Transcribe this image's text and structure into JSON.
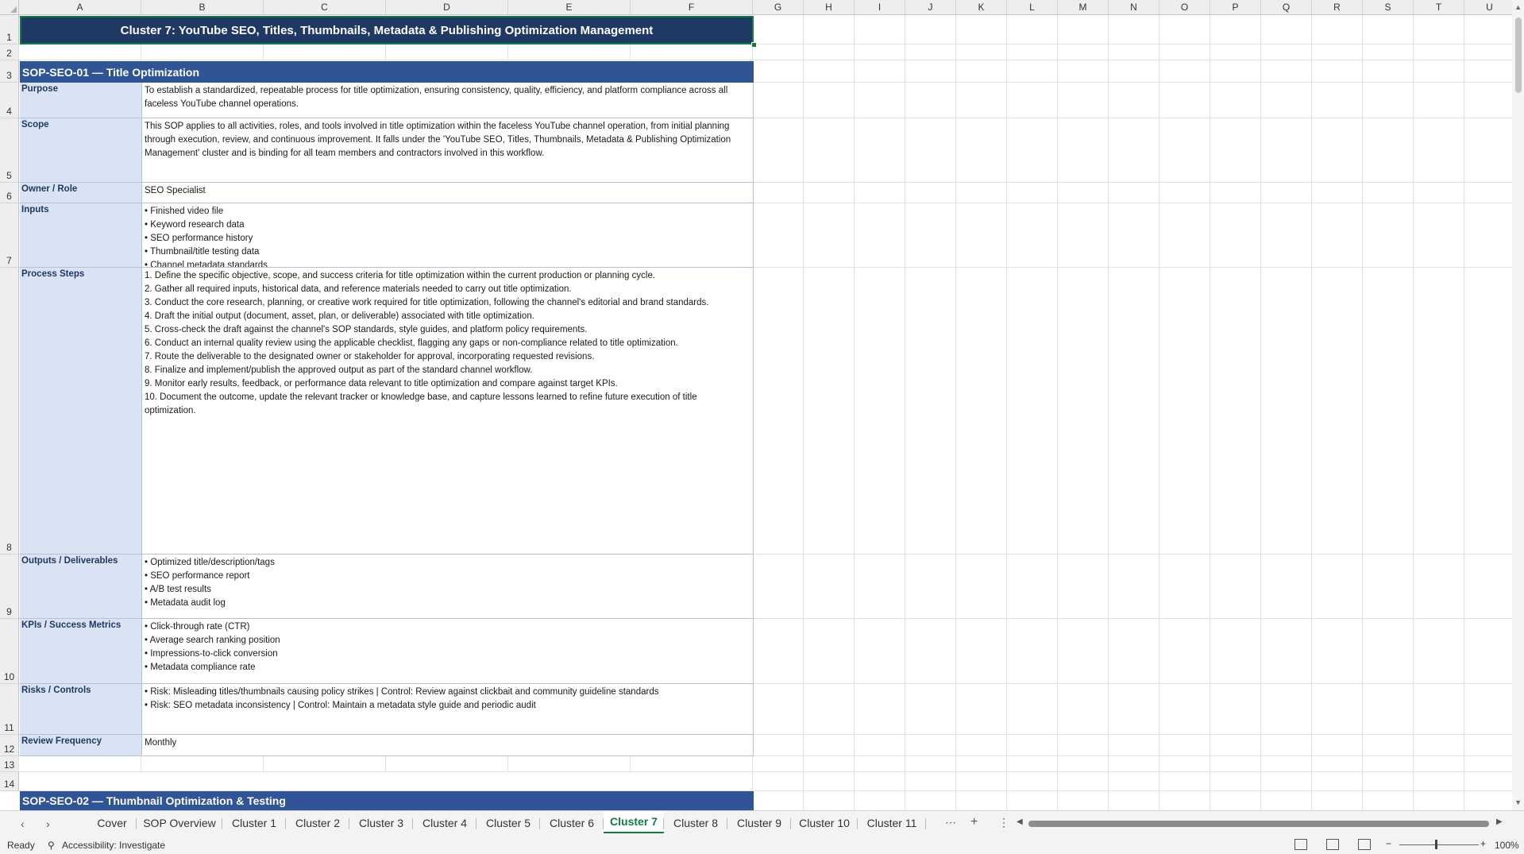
{
  "sheet": {
    "columns": [
      "A",
      "B",
      "C",
      "D",
      "E",
      "F",
      "G",
      "H",
      "I",
      "J",
      "K",
      "L",
      "M",
      "N",
      "O",
      "P",
      "Q",
      "R",
      "S",
      "T",
      "U"
    ],
    "rows": [
      "1",
      "2",
      "3",
      "4",
      "5",
      "6",
      "7",
      "8",
      "9",
      "10",
      "11",
      "12",
      "13",
      "14"
    ],
    "title": "Cluster 7: YouTube SEO, Titles, Thumbnails, Metadata & Publishing Optimization Management",
    "section1_header": "SOP-SEO-01  —  Title Optimization",
    "fields": [
      {
        "label": "Purpose",
        "value": "To establish a standardized, repeatable process for title optimization, ensuring consistency, quality, efficiency, and platform compliance across all faceless YouTube channel operations."
      },
      {
        "label": "Scope",
        "value": "This SOP applies to all activities, roles, and tools involved in title optimization within the faceless YouTube channel operation, from initial planning through execution, review, and continuous improvement. It falls under the 'YouTube SEO, Titles, Thumbnails, Metadata & Publishing Optimization Management' cluster and is binding for all team members and contractors involved in this workflow."
      },
      {
        "label": "Owner / Role",
        "value": "SEO Specialist"
      },
      {
        "label": "Inputs",
        "value": "• Finished video file\n• Keyword research data\n• SEO performance history\n• Thumbnail/title testing data\n• Channel metadata standards"
      },
      {
        "label": "Process Steps",
        "value": "1. Define the specific objective, scope, and success criteria for title optimization within the current production or planning cycle.\n2. Gather all required inputs, historical data, and reference materials needed to carry out title optimization.\n3. Conduct the core research, planning, or creative work required for title optimization, following the channel's editorial and brand standards.\n4. Draft the initial output (document, asset, plan, or deliverable) associated with title optimization.\n5. Cross-check the draft against the channel's SOP standards, style guides, and platform policy requirements.\n6. Conduct an internal quality review using the applicable checklist, flagging any gaps or non-compliance related to title optimization.\n7. Route the deliverable to the designated owner or stakeholder for approval, incorporating requested revisions.\n8. Finalize and implement/publish the approved output as part of the standard channel workflow.\n9. Monitor early results, feedback, or performance data relevant to title optimization and compare against target KPIs.\n10. Document the outcome, update the relevant tracker or knowledge base, and capture lessons learned to refine future execution of title optimization."
      },
      {
        "label": "Outputs / Deliverables",
        "value": "• Optimized title/description/tags\n• SEO performance report\n• A/B test results\n• Metadata audit log"
      },
      {
        "label": "KPIs / Success Metrics",
        "value": "• Click-through rate (CTR)\n• Average search ranking position\n• Impressions-to-click conversion\n• Metadata compliance rate"
      },
      {
        "label": "Risks / Controls",
        "value": "• Risk: Misleading titles/thumbnails causing policy strikes | Control: Review against clickbait and community guideline standards\n• Risk: SEO metadata inconsistency | Control: Maintain a metadata style guide and periodic audit"
      },
      {
        "label": "Review Frequency",
        "value": "Monthly"
      }
    ],
    "section2_header": "SOP-SEO-02  —  Thumbnail Optimization & Testing"
  },
  "tabs": [
    "Cover",
    "SOP Overview",
    "Cluster 1",
    "Cluster 2",
    "Cluster 3",
    "Cluster 4",
    "Cluster 5",
    "Cluster 6",
    "Cluster 7",
    "Cluster 8",
    "Cluster 9",
    "Cluster 10",
    "Cluster 11"
  ],
  "active_tab": "Cluster 7",
  "status": {
    "ready": "Ready",
    "accessibility": "Accessibility: Investigate",
    "zoom": "100%"
  },
  "colors": {
    "title_bg": "#1f3864",
    "section_bg": "#2f5597",
    "label_bg": "#dae3f3",
    "accent": "#107c41"
  }
}
